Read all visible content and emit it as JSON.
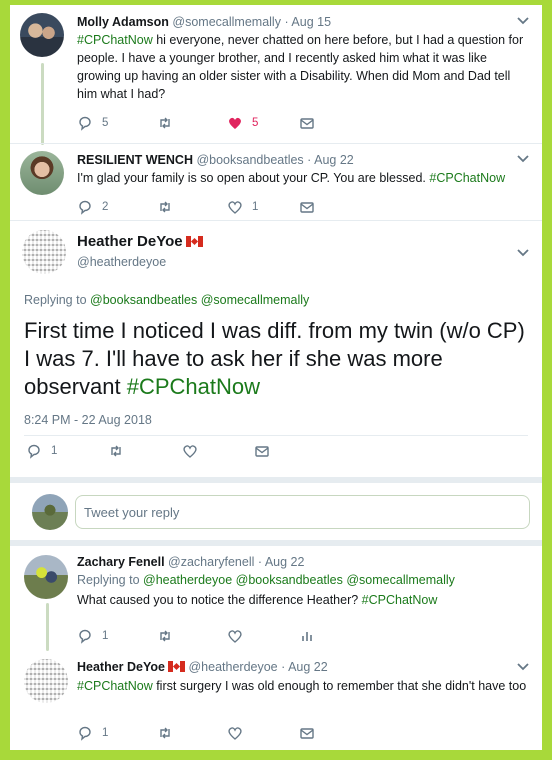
{
  "tweets": [
    {
      "name": "Molly Adamson",
      "handle": "@somecallmemally",
      "dot": "·",
      "time": "Aug 15",
      "hashtag": "#CPChatNow",
      "text_after_tag": " hi everyone, never chatted on here before, but I had a question for people. I have a younger brother, and I recently asked him what it was like growing up having an older sister with a Disability. When did Mom and Dad tell him what I had?",
      "replies": "5",
      "retweets": "",
      "likes": "5",
      "liked": true
    },
    {
      "name": "RESILIENT WENCH",
      "handle": "@booksandbeatles",
      "dot": "·",
      "time": "Aug 22",
      "text": "I'm glad your family is so open about your CP. You are blessed. ",
      "hashtag": "#CPChatNow",
      "replies": "2",
      "retweets": "",
      "likes": "1"
    }
  ],
  "focused": {
    "name": "Heather DeYoe",
    "handle": "@heatherdeyoe",
    "replying_prefix": "Replying to ",
    "replying_to": [
      "@booksandbeatles",
      "@somecallmemally"
    ],
    "text": "First time I noticed I was diff. from my twin (w/o CP) I was 7. I'll have to ask her if she was more observant ",
    "hashtag": "#CPChatNow",
    "timestamp": "8:24 PM - 22 Aug 2018",
    "replies": "1"
  },
  "reply_box": {
    "placeholder": "Tweet your reply"
  },
  "replies": [
    {
      "name": "Zachary Fenell",
      "handle": "@zacharyfenell",
      "dot": "·",
      "time": "Aug 22",
      "replying_prefix": "Replying to ",
      "replying_to": [
        "@heatherdeyoe",
        "@booksandbeatles",
        "@somecallmemally"
      ],
      "text": "What caused you to notice the difference Heather? ",
      "hashtag": "#CPChatNow",
      "replies": "1"
    },
    {
      "name": "Heather DeYoe",
      "handle": "@heatherdeyoe",
      "dot": "·",
      "time": "Aug 22",
      "hashtag": "#CPChatNow",
      "text_after_tag": " first surgery I was old enough to remember that she didn't have too",
      "replies": "1"
    }
  ],
  "colors": {
    "frame_border": "#a8d93a",
    "hashtag": "#1b7a1b",
    "like": "#e0245e",
    "muted": "#657786"
  },
  "icons": [
    "reply-icon",
    "retweet-icon",
    "like-icon",
    "message-icon",
    "analytics-icon",
    "chevron-down-icon",
    "canada-flag-icon"
  ]
}
